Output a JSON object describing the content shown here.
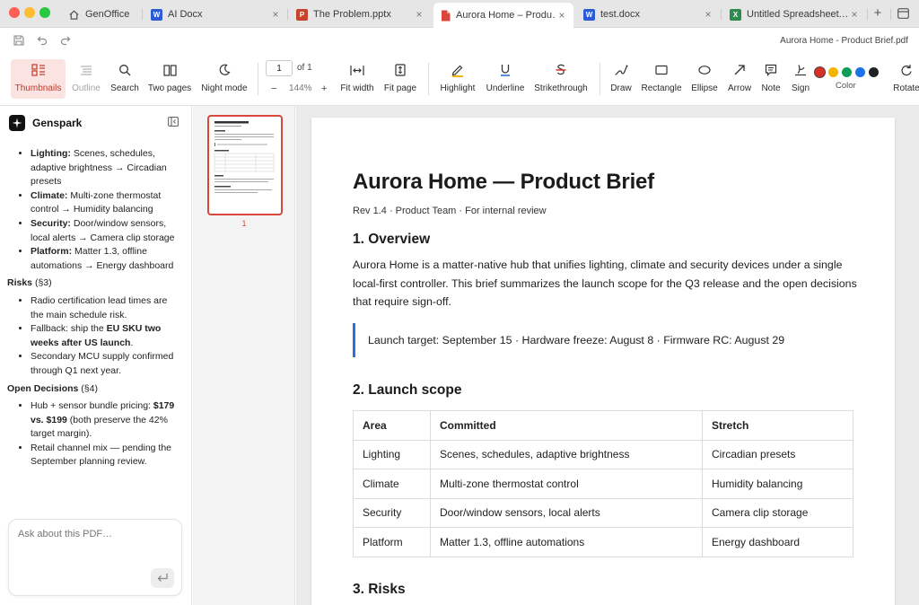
{
  "window": {
    "traffic_lights": [
      "#ff5f57",
      "#febc2e",
      "#28c840"
    ]
  },
  "tabs": [
    {
      "label": "GenOffice",
      "icon": "home-icon"
    },
    {
      "label": "AI Docx",
      "icon": "word-doc-icon",
      "badge": "W"
    },
    {
      "label": "The Problem.pptx",
      "icon": "powerpoint-icon",
      "badge": "P"
    },
    {
      "label": "Aurora Home – Produ…",
      "icon": "pdf-icon",
      "active": true
    },
    {
      "label": "test.docx",
      "icon": "word-doc-icon",
      "badge": "W"
    },
    {
      "label": "Untitled Spreadsheet.…",
      "icon": "excel-icon",
      "badge": "X"
    }
  ],
  "tab_new": "+",
  "title_row": {
    "document_title": "Aurora Home - Product Brief.pdf"
  },
  "toolbar": {
    "thumbnails": "Thumbnails",
    "outline": "Outline",
    "search": "Search",
    "two_pages": "Two pages",
    "night_mode": "Night mode",
    "page_current": "1",
    "page_of": "of 1",
    "zoom_minus": "−",
    "zoom_level": "144%",
    "zoom_plus": "+",
    "fit_width": "Fit width",
    "fit_page": "Fit page",
    "highlight": "Highlight",
    "underline": "Underline",
    "strikethrough": "Strikethrough",
    "draw": "Draw",
    "rectangle": "Rectangle",
    "ellipse": "Ellipse",
    "arrow": "Arrow",
    "note": "Note",
    "sign": "Sign",
    "color": "Color",
    "colors": [
      "#d93025",
      "#f4b400",
      "#0f9d58",
      "#1a73e8",
      "#202124"
    ],
    "rotate": "Rotate"
  },
  "sidebar": {
    "app_name": "Genspark",
    "summary": {
      "scope_items": [
        {
          "label": "Lighting:",
          "text": " Scenes, schedules, adaptive brightness → Circadian presets"
        },
        {
          "label": "Climate:",
          "text": " Multi-zone thermostat control → Humidity balancing"
        },
        {
          "label": "Security:",
          "text": " Door/window sensors, local alerts → Camera clip storage"
        },
        {
          "label": "Platform:",
          "text": " Matter 1.3, offline automations → Energy dashboard"
        }
      ],
      "risks_heading": "Risks",
      "risks_ref": " (§3)",
      "risk_1": "Radio certification lead times are the main schedule risk.",
      "risk_2_pre": "Fallback: ship the ",
      "risk_2_bold": "EU SKU two weeks after US launch",
      "risk_2_post": ".",
      "risk_3": "Secondary MCU supply confirmed through Q1 next year.",
      "open_heading": "Open Decisions",
      "open_ref": " (§4)",
      "open_1_pre": "Hub + sensor bundle pricing: ",
      "open_1_bold": "$179 vs. $199",
      "open_1_post": " (both preserve the 42% target margin).",
      "open_2": "Retail channel mix — pending the September planning review."
    },
    "chat_placeholder": "Ask about this PDF…"
  },
  "thumbnails": {
    "page_number": "1"
  },
  "document": {
    "title": "Aurora Home — Product Brief",
    "meta": "Rev 1.4 · Product Team · For internal review",
    "overview_heading": "1. Overview",
    "overview_text": "Aurora Home is a matter-native hub that unifies lighting, climate and security devices under a single local-first controller. This brief summarizes the launch scope for the Q3 release and the open decisions that require sign-off.",
    "callout": "Launch target: September 15 · Hardware freeze: August 8 · Firmware RC: August 29",
    "scope_heading": "2. Launch scope",
    "table": {
      "headers": [
        "Area",
        "Committed",
        "Stretch"
      ],
      "rows": [
        [
          "Lighting",
          "Scenes, schedules, adaptive brightness",
          "Circadian presets"
        ],
        [
          "Climate",
          "Multi-zone thermostat control",
          "Humidity balancing"
        ],
        [
          "Security",
          "Door/window sensors, local alerts",
          "Camera clip storage"
        ],
        [
          "Platform",
          "Matter 1.3, offline automations",
          "Energy dashboard"
        ]
      ]
    },
    "risks_heading": "3. Risks"
  }
}
